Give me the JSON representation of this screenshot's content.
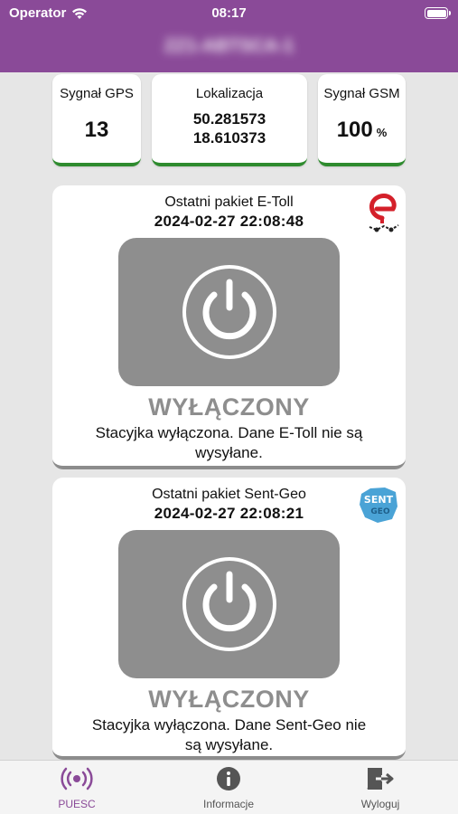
{
  "status_bar": {
    "carrier": "Operator",
    "time": "08:17"
  },
  "header": {
    "title": "ZZ1-ABTSCA-1"
  },
  "stats": {
    "gps": {
      "label": "Sygnał GPS",
      "value": "13"
    },
    "location": {
      "label": "Lokalizacja",
      "lat": "50.281573",
      "lon": "18.610373"
    },
    "gsm": {
      "label": "Sygnał GSM",
      "value": "100",
      "unit": "%"
    }
  },
  "etoll": {
    "caption": "Ostatni pakiet E-Toll",
    "datetime": "2024-02-27 22:08:48",
    "state": "WYŁĄCZONY",
    "description": "Stacyjka wyłączona. Dane E-Toll nie są wysyłane.",
    "logo_icon": "etoll-logo-icon"
  },
  "sentgeo": {
    "caption": "Ostatni pakiet Sent-Geo",
    "datetime": "2024-02-27 22:08:21",
    "state": "WYŁĄCZONY",
    "description": "Stacyjka wyłączona. Dane Sent-Geo nie są wysyłane.",
    "logo_text_1": "SENT",
    "logo_text_2": "GEO"
  },
  "tabs": [
    {
      "label": "PUESC",
      "icon": "signal-broadcast-icon",
      "active": true
    },
    {
      "label": "Informacje",
      "icon": "info-icon",
      "active": false
    },
    {
      "label": "Wyloguj",
      "icon": "logout-icon",
      "active": false
    }
  ],
  "colors": {
    "header": "#8a4a98",
    "accent_green": "#2e8b2e",
    "inactive_gray": "#8e8e8e",
    "tab_active": "#8a4a98",
    "etoll_red": "#d4202a",
    "sentgeo_blue": "#4aa3d6"
  }
}
